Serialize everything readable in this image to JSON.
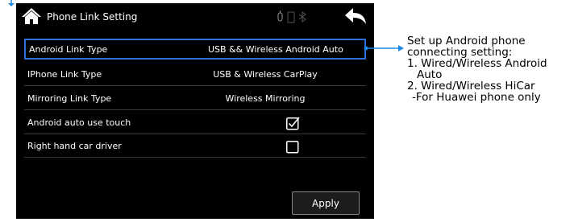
{
  "header": {
    "title": "Phone Link Setting",
    "icons": [
      "home-icon",
      "usb-icon",
      "phone-battery-icon",
      "bluetooth-icon",
      "back-icon"
    ]
  },
  "rows": [
    {
      "label": "Android Link Type",
      "value": "USB && Wireless Android Auto",
      "highlighted": true
    },
    {
      "label": "IPhone Link Type",
      "value": "USB & Wireless CarPlay"
    },
    {
      "label": "Mirroring Link Type",
      "value": "Wireless Mirroring"
    },
    {
      "label": "Android auto use touch",
      "checked": true
    },
    {
      "label": "Right hand car driver",
      "checked": false
    }
  ],
  "apply_label": "Apply",
  "annotation": {
    "lines": [
      "Set up Android phone",
      "connecting setting:",
      "1. Wired/Wireless Android",
      "Auto",
      "2. Wired/Wireless HiCar",
      "-For Huawei phone only"
    ]
  },
  "colors": {
    "screen_bg": "#000000",
    "highlight": "#2f6fdc",
    "callout": "#1e88e5",
    "text": "#ffffff"
  }
}
